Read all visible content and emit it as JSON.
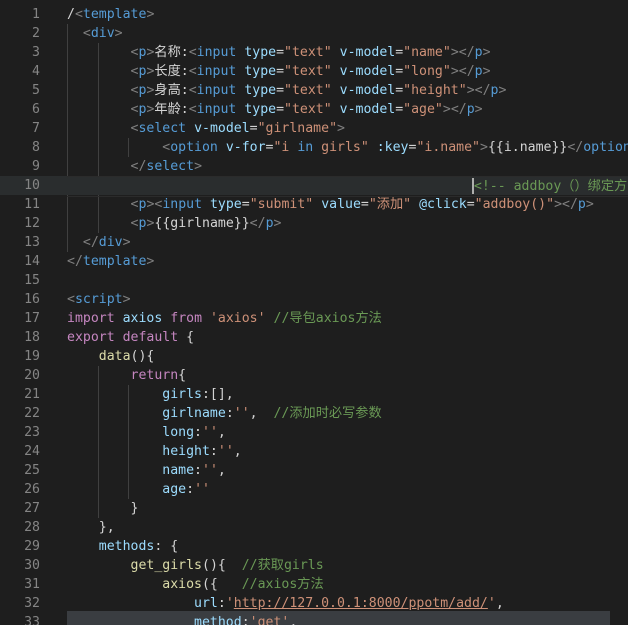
{
  "top_partial": "/</",
  "lines": [
    {
      "n": "1",
      "tokens": [
        [
          "t-text",
          "/"
        ],
        [
          "t-brk",
          "<"
        ],
        [
          "t-tag",
          "template"
        ],
        [
          "t-brk",
          ">"
        ]
      ]
    },
    {
      "n": "2",
      "tokens": [
        [
          "t-text",
          "  "
        ],
        [
          "t-brk",
          "<"
        ],
        [
          "t-tag",
          "div"
        ],
        [
          "t-brk",
          ">"
        ]
      ]
    },
    {
      "n": "3",
      "tokens": [
        [
          "t-text",
          "        "
        ],
        [
          "t-brk",
          "<"
        ],
        [
          "t-tag",
          "p"
        ],
        [
          "t-brk",
          ">"
        ],
        [
          "t-text",
          "名称:"
        ],
        [
          "t-brk",
          "<"
        ],
        [
          "t-tag",
          "input"
        ],
        [
          "t-text",
          " "
        ],
        [
          "t-attr",
          "type"
        ],
        [
          "t-text",
          "="
        ],
        [
          "t-str",
          "\"text\""
        ],
        [
          "t-text",
          " "
        ],
        [
          "t-attr",
          "v-model"
        ],
        [
          "t-text",
          "="
        ],
        [
          "t-str",
          "\"name\""
        ],
        [
          "t-brk",
          "></"
        ],
        [
          "t-tag",
          "p"
        ],
        [
          "t-brk",
          ">"
        ]
      ]
    },
    {
      "n": "4",
      "tokens": [
        [
          "t-text",
          "        "
        ],
        [
          "t-brk",
          "<"
        ],
        [
          "t-tag",
          "p"
        ],
        [
          "t-brk",
          ">"
        ],
        [
          "t-text",
          "长度:"
        ],
        [
          "t-brk",
          "<"
        ],
        [
          "t-tag",
          "input"
        ],
        [
          "t-text",
          " "
        ],
        [
          "t-attr",
          "type"
        ],
        [
          "t-text",
          "="
        ],
        [
          "t-str",
          "\"text\""
        ],
        [
          "t-text",
          " "
        ],
        [
          "t-attr",
          "v-model"
        ],
        [
          "t-text",
          "="
        ],
        [
          "t-str",
          "\"long\""
        ],
        [
          "t-brk",
          "></"
        ],
        [
          "t-tag",
          "p"
        ],
        [
          "t-brk",
          ">"
        ]
      ]
    },
    {
      "n": "5",
      "tokens": [
        [
          "t-text",
          "        "
        ],
        [
          "t-brk",
          "<"
        ],
        [
          "t-tag",
          "p"
        ],
        [
          "t-brk",
          ">"
        ],
        [
          "t-text",
          "身高:"
        ],
        [
          "t-brk",
          "<"
        ],
        [
          "t-tag",
          "input"
        ],
        [
          "t-text",
          " "
        ],
        [
          "t-attr",
          "type"
        ],
        [
          "t-text",
          "="
        ],
        [
          "t-str",
          "\"text\""
        ],
        [
          "t-text",
          " "
        ],
        [
          "t-attr",
          "v-model"
        ],
        [
          "t-text",
          "="
        ],
        [
          "t-str",
          "\"height\""
        ],
        [
          "t-brk",
          "></"
        ],
        [
          "t-tag",
          "p"
        ],
        [
          "t-brk",
          ">"
        ]
      ]
    },
    {
      "n": "6",
      "tokens": [
        [
          "t-text",
          "        "
        ],
        [
          "t-brk",
          "<"
        ],
        [
          "t-tag",
          "p"
        ],
        [
          "t-brk",
          ">"
        ],
        [
          "t-text",
          "年龄:"
        ],
        [
          "t-brk",
          "<"
        ],
        [
          "t-tag",
          "input"
        ],
        [
          "t-text",
          " "
        ],
        [
          "t-attr",
          "type"
        ],
        [
          "t-text",
          "="
        ],
        [
          "t-str",
          "\"text\""
        ],
        [
          "t-text",
          " "
        ],
        [
          "t-attr",
          "v-model"
        ],
        [
          "t-text",
          "="
        ],
        [
          "t-str",
          "\"age\""
        ],
        [
          "t-brk",
          "></"
        ],
        [
          "t-tag",
          "p"
        ],
        [
          "t-brk",
          ">"
        ]
      ]
    },
    {
      "n": "7",
      "tokens": [
        [
          "t-text",
          "        "
        ],
        [
          "t-brk",
          "<"
        ],
        [
          "t-tag",
          "select"
        ],
        [
          "t-text",
          " "
        ],
        [
          "t-attr",
          "v-model"
        ],
        [
          "t-text",
          "="
        ],
        [
          "t-str",
          "\"girlname\""
        ],
        [
          "t-brk",
          ">"
        ]
      ]
    },
    {
      "n": "8",
      "tokens": [
        [
          "t-text",
          "            "
        ],
        [
          "t-brk",
          "<"
        ],
        [
          "t-tag",
          "option"
        ],
        [
          "t-text",
          " "
        ],
        [
          "t-attr",
          "v-for"
        ],
        [
          "t-text",
          "="
        ],
        [
          "t-str",
          "\"i "
        ],
        [
          "t-kw2",
          "in"
        ],
        [
          "t-str",
          " girls\""
        ],
        [
          "t-text",
          " "
        ],
        [
          "t-attr",
          ":key"
        ],
        [
          "t-text",
          "="
        ],
        [
          "t-str",
          "\"i.name\""
        ],
        [
          "t-brk",
          ">"
        ],
        [
          "t-text",
          "{{i.name}}"
        ],
        [
          "t-brk",
          "</"
        ],
        [
          "t-tag",
          "option"
        ]
      ]
    },
    {
      "n": "9",
      "tokens": [
        [
          "t-text",
          "        "
        ],
        [
          "t-brk",
          "</"
        ],
        [
          "t-tag",
          "select"
        ],
        [
          "t-brk",
          ">"
        ]
      ]
    },
    {
      "n": "10",
      "tokens": [
        [
          "t-text",
          "                                                   "
        ],
        [
          "caret",
          ""
        ],
        [
          "t-cmt",
          "<!-- addboy（）绑定方法 -->"
        ]
      ]
    },
    {
      "n": "11",
      "tokens": [
        [
          "t-text",
          "        "
        ],
        [
          "t-brk",
          "<"
        ],
        [
          "t-tag",
          "p"
        ],
        [
          "t-brk",
          "><"
        ],
        [
          "t-tag",
          "input"
        ],
        [
          "t-text",
          " "
        ],
        [
          "t-attr",
          "type"
        ],
        [
          "t-text",
          "="
        ],
        [
          "t-str",
          "\"submit\""
        ],
        [
          "t-text",
          " "
        ],
        [
          "t-attr",
          "value"
        ],
        [
          "t-text",
          "="
        ],
        [
          "t-str",
          "\"添加\""
        ],
        [
          "t-text",
          " "
        ],
        [
          "t-attr",
          "@click"
        ],
        [
          "t-text",
          "="
        ],
        [
          "t-str",
          "\"addboy()\""
        ],
        [
          "t-brk",
          "></"
        ],
        [
          "t-tag",
          "p"
        ],
        [
          "t-brk",
          ">"
        ]
      ]
    },
    {
      "n": "12",
      "tokens": [
        [
          "t-text",
          "        "
        ],
        [
          "t-brk",
          "<"
        ],
        [
          "t-tag",
          "p"
        ],
        [
          "t-brk",
          ">"
        ],
        [
          "t-text",
          "{{girlname}}"
        ],
        [
          "t-brk",
          "</"
        ],
        [
          "t-tag",
          "p"
        ],
        [
          "t-brk",
          ">"
        ]
      ]
    },
    {
      "n": "13",
      "tokens": [
        [
          "t-text",
          "  "
        ],
        [
          "t-brk",
          "</"
        ],
        [
          "t-tag",
          "div"
        ],
        [
          "t-brk",
          ">"
        ]
      ]
    },
    {
      "n": "14",
      "tokens": [
        [
          "t-brk",
          "</"
        ],
        [
          "t-tag",
          "template"
        ],
        [
          "t-brk",
          ">"
        ]
      ]
    },
    {
      "n": "15",
      "tokens": []
    },
    {
      "n": "16",
      "tokens": [
        [
          "t-brk",
          "<"
        ],
        [
          "t-tag",
          "script"
        ],
        [
          "t-brk",
          ">"
        ]
      ]
    },
    {
      "n": "17",
      "tokens": [
        [
          "t-kw",
          "import"
        ],
        [
          "t-text",
          " "
        ],
        [
          "t-var",
          "axios"
        ],
        [
          "t-text",
          " "
        ],
        [
          "t-kw",
          "from"
        ],
        [
          "t-text",
          " "
        ],
        [
          "t-str",
          "'axios'"
        ],
        [
          "t-text",
          " "
        ],
        [
          "t-cmt",
          "//导包axios方法"
        ]
      ]
    },
    {
      "n": "18",
      "tokens": [
        [
          "t-kw",
          "export"
        ],
        [
          "t-text",
          " "
        ],
        [
          "t-kw",
          "default"
        ],
        [
          "t-text",
          " {"
        ]
      ]
    },
    {
      "n": "19",
      "tokens": [
        [
          "t-text",
          "    "
        ],
        [
          "t-fn",
          "data"
        ],
        [
          "t-text",
          "(){"
        ]
      ]
    },
    {
      "n": "20",
      "tokens": [
        [
          "t-text",
          "        "
        ],
        [
          "t-kw",
          "return"
        ],
        [
          "t-text",
          "{"
        ]
      ]
    },
    {
      "n": "21",
      "tokens": [
        [
          "t-text",
          "            "
        ],
        [
          "t-var",
          "girls"
        ],
        [
          "t-text",
          ":[],"
        ]
      ]
    },
    {
      "n": "22",
      "tokens": [
        [
          "t-text",
          "            "
        ],
        [
          "t-var",
          "girlname"
        ],
        [
          "t-text",
          ":"
        ],
        [
          "t-str",
          "''"
        ],
        [
          "t-text",
          ",  "
        ],
        [
          "t-cmt",
          "//添加时必写参数"
        ]
      ]
    },
    {
      "n": "23",
      "tokens": [
        [
          "t-text",
          "            "
        ],
        [
          "t-var",
          "long"
        ],
        [
          "t-text",
          ":"
        ],
        [
          "t-str",
          "''"
        ],
        [
          "t-text",
          ","
        ]
      ]
    },
    {
      "n": "24",
      "tokens": [
        [
          "t-text",
          "            "
        ],
        [
          "t-var",
          "height"
        ],
        [
          "t-text",
          ":"
        ],
        [
          "t-str",
          "''"
        ],
        [
          "t-text",
          ","
        ]
      ]
    },
    {
      "n": "25",
      "tokens": [
        [
          "t-text",
          "            "
        ],
        [
          "t-var",
          "name"
        ],
        [
          "t-text",
          ":"
        ],
        [
          "t-str",
          "''"
        ],
        [
          "t-text",
          ","
        ]
      ]
    },
    {
      "n": "26",
      "tokens": [
        [
          "t-text",
          "            "
        ],
        [
          "t-var",
          "age"
        ],
        [
          "t-text",
          ":"
        ],
        [
          "t-str",
          "''"
        ]
      ]
    },
    {
      "n": "27",
      "tokens": [
        [
          "t-text",
          "        }"
        ]
      ]
    },
    {
      "n": "28",
      "tokens": [
        [
          "t-text",
          "    },"
        ]
      ]
    },
    {
      "n": "29",
      "tokens": [
        [
          "t-text",
          "    "
        ],
        [
          "t-var",
          "methods"
        ],
        [
          "t-text",
          ": {"
        ]
      ]
    },
    {
      "n": "30",
      "tokens": [
        [
          "t-text",
          "        "
        ],
        [
          "t-fn",
          "get_girls"
        ],
        [
          "t-text",
          "(){  "
        ],
        [
          "t-cmt",
          "//获取girls"
        ]
      ]
    },
    {
      "n": "31",
      "tokens": [
        [
          "t-text",
          "            "
        ],
        [
          "t-fn",
          "axios"
        ],
        [
          "t-text",
          "({   "
        ],
        [
          "t-cmt",
          "//axios方法"
        ]
      ]
    },
    {
      "n": "32",
      "tokens": [
        [
          "t-text",
          "                "
        ],
        [
          "t-var",
          "url"
        ],
        [
          "t-text",
          ":"
        ],
        [
          "t-str",
          "'"
        ],
        [
          "t-url",
          "http://127.0.0.1:8000/ppotm/add/"
        ],
        [
          "t-str",
          "'"
        ],
        [
          "t-text",
          ","
        ]
      ]
    },
    {
      "n": "33",
      "tokens": [
        [
          "t-text",
          "                "
        ],
        [
          "t-var",
          "method"
        ],
        [
          "t-text",
          ":"
        ],
        [
          "t-str",
          "'get'"
        ],
        [
          "t-text",
          ","
        ]
      ]
    }
  ]
}
